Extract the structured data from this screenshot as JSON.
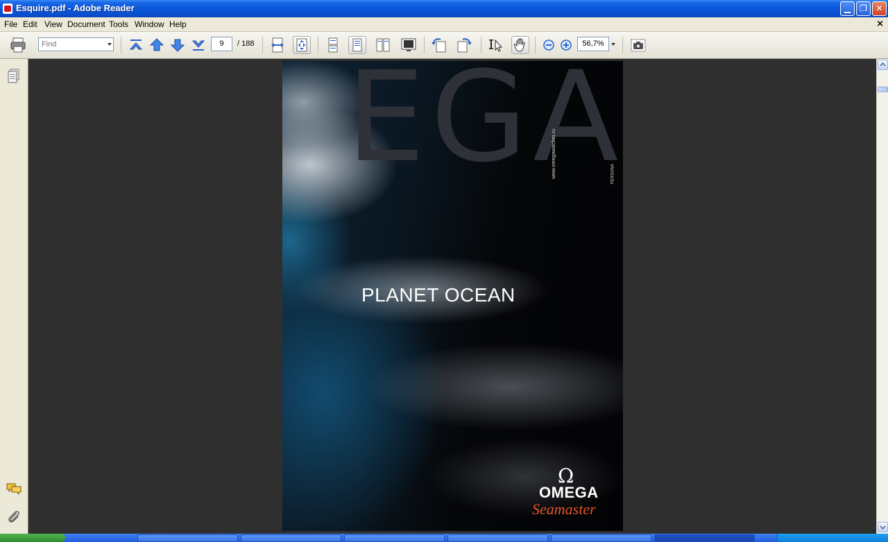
{
  "window": {
    "title": "Esquire.pdf - Adobe Reader",
    "minimize_glyph": "▁",
    "restore_glyph": "❐",
    "close_glyph": "✕"
  },
  "menu": {
    "items": [
      "File",
      "Edit",
      "View",
      "Document",
      "Tools",
      "Window",
      "Help"
    ],
    "doc_close_glyph": "×"
  },
  "toolbar": {
    "find_placeholder": "Find",
    "current_page": "9",
    "page_total": "/ 188",
    "zoom": "56,7%",
    "icons": [
      "print-icon",
      "first-page-icon",
      "previous-page-icon",
      "next-page-icon",
      "last-page-icon",
      "fit-width-icon",
      "fit-page-icon",
      "single-page-icon",
      "single-page-continuous-icon",
      "two-up-icon",
      "full-screen-icon",
      "rotate-counterclockwise-icon",
      "rotate-clockwise-icon",
      "select-tool-icon",
      "hand-tool-icon",
      "zoom-out-icon",
      "zoom-in-icon",
      "snapshot-icon"
    ]
  },
  "document_page": {
    "big_word": "EGA",
    "headline": "PLANET OCEAN",
    "side_text": "www.omegawatches.ru",
    "side_text_small": "PERSONA",
    "brand_symbol": "Ω",
    "brand": "OMEGA",
    "sub_brand": "Seamaster"
  },
  "nav_panel": {
    "icons": [
      "pages-icon",
      "comments-icon",
      "attachments-icon"
    ]
  },
  "colors": {
    "titlebar": "#0a55d8",
    "menubar": "#ece9d8",
    "doc_background": "#2f2f2f",
    "seamaster_orange": "#e4562a"
  }
}
